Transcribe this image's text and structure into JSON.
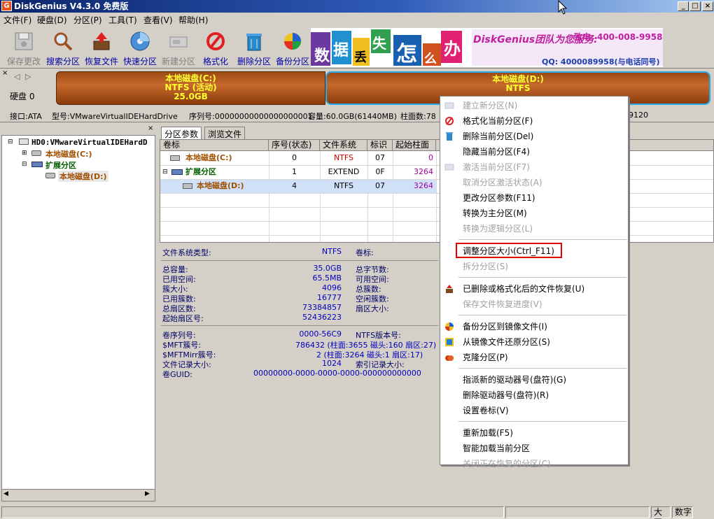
{
  "window": {
    "title": "DiskGenius V4.3.0 免费版",
    "icon_label": "G"
  },
  "menu": [
    "文件(F)",
    "硬盘(D)",
    "分区(P)",
    "工具(T)",
    "查看(V)",
    "帮助(H)"
  ],
  "toolbar": [
    {
      "label": "保存更改",
      "icon": "save-icon",
      "disabled": true
    },
    {
      "label": "搜索分区",
      "icon": "search-icon",
      "disabled": false
    },
    {
      "label": "恢复文件",
      "icon": "recover-file-icon",
      "disabled": false
    },
    {
      "label": "快速分区",
      "icon": "quick-partition-icon",
      "disabled": false
    },
    {
      "label": "新建分区",
      "icon": "new-partition-icon",
      "disabled": true
    },
    {
      "label": "格式化",
      "icon": "format-icon",
      "disabled": false
    },
    {
      "label": "删除分区",
      "icon": "delete-partition-icon",
      "disabled": false
    },
    {
      "label": "备份分区",
      "icon": "backup-partition-icon",
      "disabled": false
    }
  ],
  "banner": {
    "tiles": [
      "数",
      "据",
      "丢",
      "失",
      "怎",
      "么",
      "办"
    ],
    "team_text": "DiskGenius团队为您服务:",
    "phone": "致电: 400-008-9958",
    "qq": "QQ: 4000089958(与电话同号)"
  },
  "diskmap": {
    "disk_label": "硬盘 0",
    "partitions": [
      {
        "name": "本地磁盘(C:)",
        "fs": "NTFS (活动)",
        "size": "25.0GB"
      },
      {
        "name": "本地磁盘(D:)",
        "fs": "NTFS"
      }
    ]
  },
  "infoline": {
    "interface": "接口:ATA",
    "model": "型号:VMwareVirtualIDEHardDrive",
    "serial": "序列号:00000000000000000001",
    "capacity": "容量:60.0GB(61440MB)",
    "cylinders": "柱面数:78",
    "tail": "9120"
  },
  "tree": {
    "root": "HD0:VMwareVirtualIDEHardD",
    "items": [
      "本地磁盘(C:)",
      "扩展分区",
      "本地磁盘(D:)"
    ]
  },
  "tabs": [
    "分区参数",
    "浏览文件"
  ],
  "grid": {
    "headers": [
      "卷标",
      "序号(状态)",
      "文件系统",
      "标识",
      "起始柱面"
    ],
    "rows": [
      {
        "label": "本地磁盘(C:)",
        "index": "0",
        "fs": "NTFS",
        "id": "07",
        "start": "0"
      },
      {
        "label": "扩展分区",
        "index": "1",
        "fs": "EXTEND",
        "id": "0F",
        "start": "3264"
      },
      {
        "label": "本地磁盘(D:)",
        "index": "4",
        "fs": "NTFS",
        "id": "07",
        "start": "3264"
      }
    ]
  },
  "details": {
    "fs_type_label": "文件系统类型:",
    "fs_type": "NTFS",
    "volume_label": "卷标:",
    "rows": [
      {
        "label": "总容量:",
        "value": "35.0GB",
        "label2": "总字节数:"
      },
      {
        "label": "已用空间:",
        "value": "65.5MB",
        "label2": "可用空间:"
      },
      {
        "label": "簇大小:",
        "value": "4096",
        "label2": "总簇数:"
      },
      {
        "label": "已用簇数:",
        "value": "16777",
        "label2": "空闲簇数:"
      },
      {
        "label": "总扇区数:",
        "value": "73384857",
        "label2": "扇区大小:"
      },
      {
        "label": "起始扇区号:",
        "value": "52436223",
        "label2": ""
      }
    ],
    "rows2": [
      {
        "label": "卷序列号:",
        "value": "0000-56C9",
        "label2": "NTFS版本号:"
      },
      {
        "label": "$MFT簇号:",
        "value": "786432 (柱面:3655 磁头:160 扇区:27)",
        "label2": ""
      },
      {
        "label": "$MFTMirr簇号:",
        "value": "2 (柱面:3264 磁头:1 扇区:17)",
        "label2": ""
      },
      {
        "label": "文件记录大小:",
        "value": "1024",
        "label2": "索引记录大小:"
      },
      {
        "label": "卷GUID:",
        "value": "00000000-0000-0000-0000-000000000000",
        "label2": ""
      }
    ]
  },
  "context_menu": [
    {
      "label": "建立新分区(N)",
      "disabled": true,
      "icon": "new-partition-icon"
    },
    {
      "label": "格式化当前分区(F)",
      "disabled": false,
      "icon": "format-icon"
    },
    {
      "label": "删除当前分区(Del)",
      "disabled": false,
      "icon": "delete-icon"
    },
    {
      "label": "隐藏当前分区(F4)",
      "disabled": false,
      "icon": ""
    },
    {
      "label": "激活当前分区(F7)",
      "disabled": true,
      "icon": "activate-icon"
    },
    {
      "label": "取消分区激活状态(A)",
      "disabled": true,
      "icon": ""
    },
    {
      "label": "更改分区参数(F11)",
      "disabled": false,
      "icon": ""
    },
    {
      "label": "转换为主分区(M)",
      "disabled": false,
      "icon": ""
    },
    {
      "label": "转换为逻辑分区(L)",
      "disabled": true,
      "icon": ""
    },
    {
      "sep": true
    },
    {
      "label": "调整分区大小(Ctrl_F11)",
      "disabled": false,
      "icon": "",
      "highlight": true
    },
    {
      "label": "拆分分区(S)",
      "disabled": true,
      "icon": ""
    },
    {
      "sep": true
    },
    {
      "label": "已删除或格式化后的文件恢复(U)",
      "disabled": false,
      "icon": "recover-file-icon"
    },
    {
      "label": "保存文件恢复进度(V)",
      "disabled": true,
      "icon": ""
    },
    {
      "sep": true
    },
    {
      "label": "备份分区到镜像文件(I)",
      "disabled": false,
      "icon": "backup-icon"
    },
    {
      "label": "从镜像文件还原分区(S)",
      "disabled": false,
      "icon": "restore-icon"
    },
    {
      "label": "克隆分区(P)",
      "disabled": false,
      "icon": "clone-icon"
    },
    {
      "sep": true
    },
    {
      "label": "指派新的驱动器号(盘符)(G)",
      "disabled": false,
      "icon": ""
    },
    {
      "label": "删除驱动器号(盘符)(R)",
      "disabled": false,
      "icon": ""
    },
    {
      "label": "设置卷标(V)",
      "disabled": false,
      "icon": ""
    },
    {
      "sep": true
    },
    {
      "label": "重新加载(F5)",
      "disabled": false,
      "icon": ""
    },
    {
      "label": "智能加载当前分区",
      "disabled": false,
      "icon": ""
    },
    {
      "label": "关闭正在恢复的分区(C)",
      "disabled": true,
      "icon": ""
    }
  ],
  "statusbar": {
    "caps": "大写",
    "num": "数字"
  },
  "colors": {
    "title_bar": "#0a246a",
    "partition_fill": "#c7692c",
    "partition_text": "#ffff30",
    "selected_row": "#cfe0f7",
    "highlight_border": "#e00000"
  }
}
